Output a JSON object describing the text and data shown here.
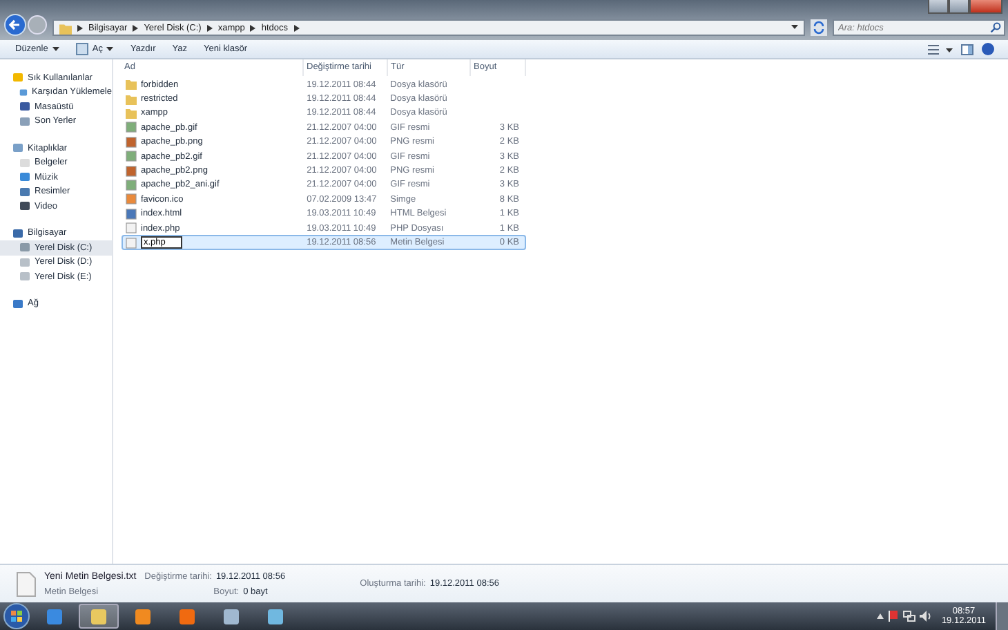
{
  "address_bar": {
    "path": [
      "Bilgisayar",
      "Yerel Disk (C:)",
      "xampp",
      "htdocs"
    ]
  },
  "search": {
    "placeholder": "Ara: htdocs"
  },
  "toolbar": [
    {
      "label": "Düzenle",
      "kind": "menu"
    },
    {
      "label": "Aç",
      "kind": "open"
    },
    {
      "label": "Yazdır",
      "kind": "plain"
    },
    {
      "label": "Yaz",
      "kind": "plain"
    },
    {
      "label": "Yeni klasör",
      "kind": "plain"
    }
  ],
  "sidebar": {
    "groups": [
      {
        "label": "Sık Kullanılanlar",
        "kind": "star",
        "children": [
          {
            "label": "Karşıdan Yüklemele",
            "kind": "download",
            "selected": false
          },
          {
            "label": "Masaüstü",
            "kind": "desktop",
            "selected": false
          },
          {
            "label": "Son Yerler",
            "kind": "recent",
            "selected": false
          }
        ]
      },
      {
        "label": "Kitaplıklar",
        "kind": "library",
        "children": [
          {
            "label": "Belgeler",
            "kind": "doc",
            "selected": false
          },
          {
            "label": "Müzik",
            "kind": "music",
            "selected": false
          },
          {
            "label": "Resimler",
            "kind": "picture",
            "selected": false
          },
          {
            "label": "Video",
            "kind": "video",
            "selected": false
          }
        ]
      },
      {
        "label": "Bilgisayar",
        "kind": "computer",
        "children": [
          {
            "label": "Yerel Disk (C:)",
            "kind": "sysdrive",
            "selected": true
          },
          {
            "label": "Yerel Disk (D:)",
            "kind": "drive",
            "selected": false
          },
          {
            "label": "Yerel Disk (E:)",
            "kind": "drive",
            "selected": false
          }
        ]
      },
      {
        "label": "Ağ",
        "kind": "network"
      }
    ]
  },
  "table": {
    "columns": [
      "Ad",
      "Değiştirme tarihi",
      "Tür",
      "Boyut"
    ],
    "rows": [
      {
        "name": "forbidden",
        "date": "19.12.2011 08:44",
        "type": "Dosya klasörü",
        "kind": "folder",
        "selected": false
      },
      {
        "name": "restricted",
        "date": "19.12.2011 08:44",
        "type": "Dosya klasörü",
        "kind": "folder",
        "selected": false
      },
      {
        "name": "xampp",
        "date": "19.12.2011 08:44",
        "type": "Dosya klasörü",
        "kind": "folder",
        "selected": false
      },
      {
        "name": "apache_pb.gif",
        "date": "21.12.2007 04:00",
        "type": "GIF resmi",
        "size": "3 KB",
        "kind": "gif",
        "selected": false
      },
      {
        "name": "apache_pb.png",
        "date": "21.12.2007 04:00",
        "type": "PNG resmi",
        "size": "2 KB",
        "kind": "png",
        "selected": false
      },
      {
        "name": "apache_pb2.gif",
        "date": "21.12.2007 04:00",
        "type": "GIF resmi",
        "size": "3 KB",
        "kind": "gif",
        "selected": false
      },
      {
        "name": "apache_pb2.png",
        "date": "21.12.2007 04:00",
        "type": "PNG resmi",
        "size": "2 KB",
        "kind": "png",
        "selected": false
      },
      {
        "name": "apache_pb2_ani.gif",
        "date": "21.12.2007 04:00",
        "type": "GIF resmi",
        "size": "3 KB",
        "kind": "gif",
        "selected": false
      },
      {
        "name": "favicon.ico",
        "date": "07.02.2009 13:47",
        "type": "Simge",
        "size": "8 KB",
        "kind": "ico",
        "selected": false
      },
      {
        "name": "index.html",
        "date": "19.03.2011 10:49",
        "type": "HTML Belgesi",
        "size": "1 KB",
        "kind": "html",
        "selected": false
      },
      {
        "name": "index.php",
        "date": "19.03.2011 10:49",
        "type": "PHP Dosyası",
        "size": "1 KB",
        "kind": "txt",
        "selected": false
      },
      {
        "name": "x.php",
        "date": "19.12.2011 08:56",
        "type": "Metin Belgesi",
        "size": "0 KB",
        "kind": "txt",
        "selected": true,
        "renaming": true
      }
    ]
  },
  "details": {
    "file_name": "Yeni Metin Belgesi.txt",
    "file_type": "Metin Belgesi",
    "fields": [
      {
        "label": "Değiştirme tarihi:",
        "value": "19.12.2011 08:56"
      },
      {
        "label": "Boyut:",
        "value": "0 bayt"
      },
      {
        "label": "Oluşturma tarihi:",
        "value": "19.12.2011 08:56"
      }
    ]
  },
  "taskbar": {
    "apps": [
      {
        "kind": "ie",
        "selected": false
      },
      {
        "kind": "explorer",
        "selected": true
      },
      {
        "kind": "media",
        "selected": false
      },
      {
        "kind": "xampp",
        "selected": false
      },
      {
        "kind": "paint",
        "selected": false
      },
      {
        "kind": "notes",
        "selected": false
      }
    ],
    "time": "08:57",
    "date": "19.12.2011"
  }
}
